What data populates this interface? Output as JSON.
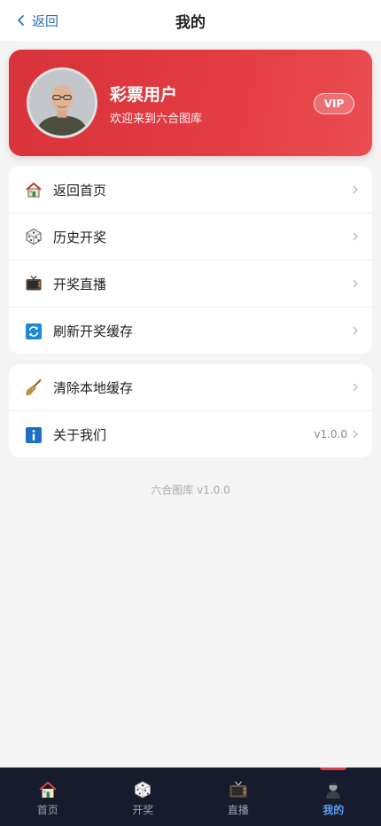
{
  "header": {
    "back_label": "返回",
    "title": "我的"
  },
  "profile": {
    "name": "彩票用户",
    "subtitle": "欢迎来到六合图库",
    "badge": "VIP"
  },
  "menu_group_1": [
    {
      "label": "返回首页",
      "icon": "house-icon"
    },
    {
      "label": "历史开奖",
      "icon": "dice-icon"
    },
    {
      "label": "开奖直播",
      "icon": "tv-icon"
    },
    {
      "label": "刷新开奖缓存",
      "icon": "refresh-icon"
    }
  ],
  "menu_group_2": [
    {
      "label": "清除本地缓存",
      "icon": "broom-icon"
    },
    {
      "label": "关于我们",
      "icon": "info-icon",
      "value": "v1.0.0"
    }
  ],
  "footer_version": "六合图库 v1.0.0",
  "bottom_nav": [
    {
      "label": "首页",
      "icon": "house-icon"
    },
    {
      "label": "开奖",
      "icon": "dice-icon"
    },
    {
      "label": "直播",
      "icon": "tv-icon"
    },
    {
      "label": "我的",
      "icon": "user-icon",
      "active": true
    }
  ],
  "colors": {
    "brand_red": "#e23b41",
    "link_blue": "#2f6fb3",
    "nav_bg": "#161c2d",
    "nav_active": "#5b9df0"
  }
}
